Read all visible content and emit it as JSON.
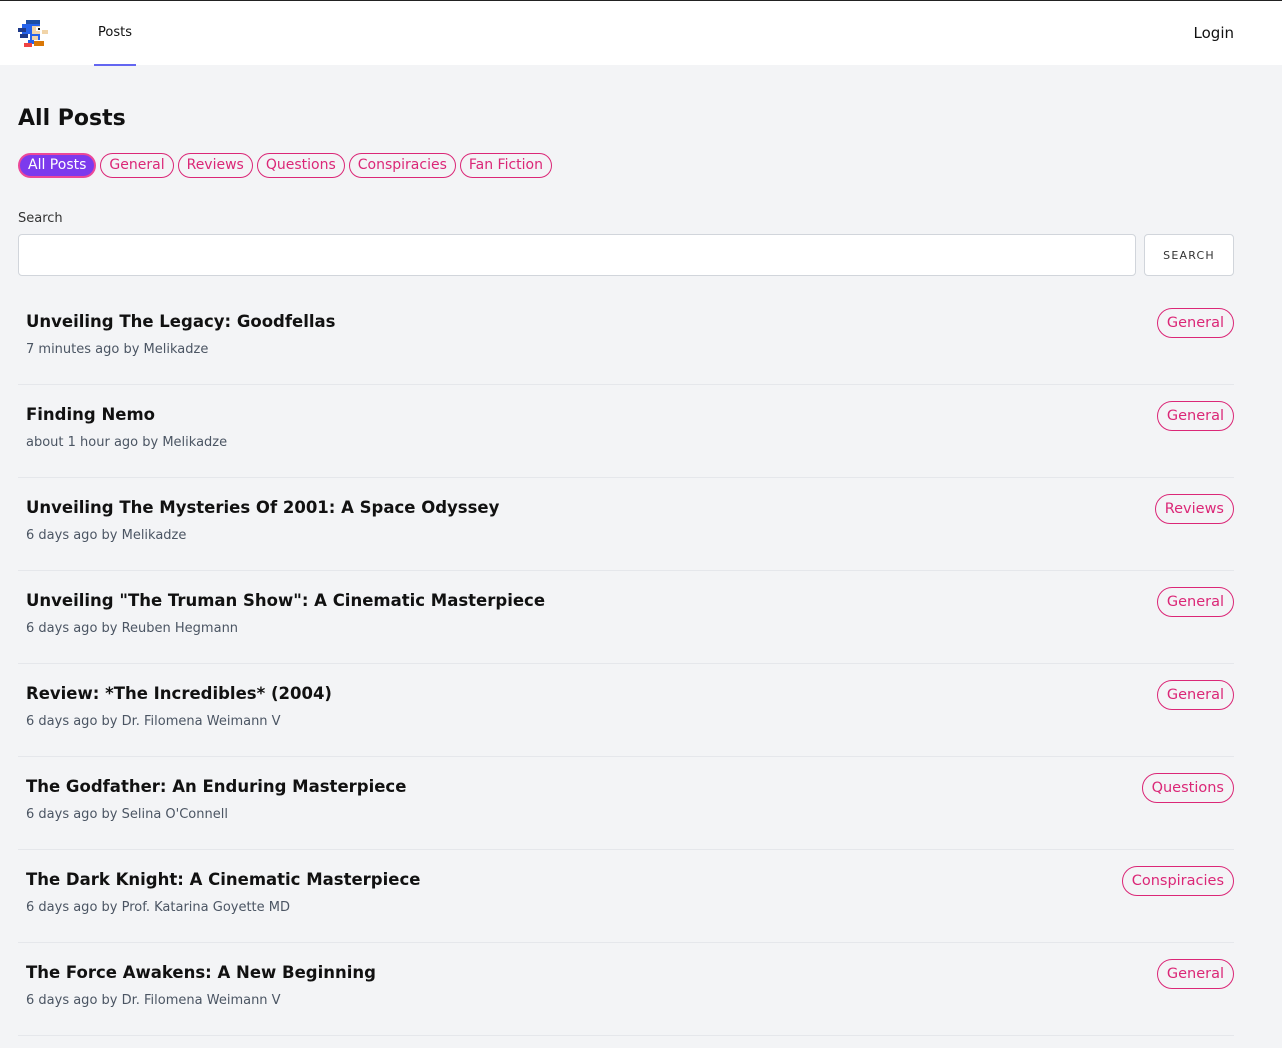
{
  "header": {
    "logo_icon": "sonic-logo-icon",
    "nav_tab": "Posts",
    "login": "Login",
    "accent": "#6366f1"
  },
  "main": {
    "title": "All Posts",
    "filters": [
      "All Posts",
      "General",
      "Reviews",
      "Questions",
      "Conspiracies",
      "Fan Fiction"
    ],
    "active_filter": "All Posts",
    "search": {
      "label": "Search",
      "value": "",
      "placeholder": "",
      "button": "SEARCH"
    },
    "posts": [
      {
        "title": "Unveiling The Legacy: Goodfellas",
        "meta": "7 minutes ago by Melikadze",
        "tag": "General"
      },
      {
        "title": "Finding Nemo",
        "meta": "about 1 hour ago by Melikadze",
        "tag": "General"
      },
      {
        "title": "Unveiling The Mysteries Of 2001: A Space Odyssey",
        "meta": "6 days ago by Melikadze",
        "tag": "Reviews"
      },
      {
        "title": "Unveiling \"The Truman Show\": A Cinematic Masterpiece",
        "meta": "6 days ago by Reuben Hegmann",
        "tag": "General"
      },
      {
        "title": "Review: *The Incredibles* (2004)",
        "meta": "6 days ago by Dr. Filomena Weimann V",
        "tag": "General"
      },
      {
        "title": "The Godfather: An Enduring Masterpiece",
        "meta": "6 days ago by Selina O'Connell",
        "tag": "Questions"
      },
      {
        "title": "The Dark Knight: A Cinematic Masterpiece",
        "meta": "6 days ago by Prof. Katarina Goyette MD",
        "tag": "Conspiracies"
      },
      {
        "title": "The Force Awakens: A New Beginning",
        "meta": "6 days ago by Dr. Filomena Weimann V",
        "tag": "General"
      }
    ]
  },
  "colors": {
    "tag": "#db2777",
    "active_chip_bg": "#7c3aed",
    "page_bg": "#f3f4f6"
  }
}
